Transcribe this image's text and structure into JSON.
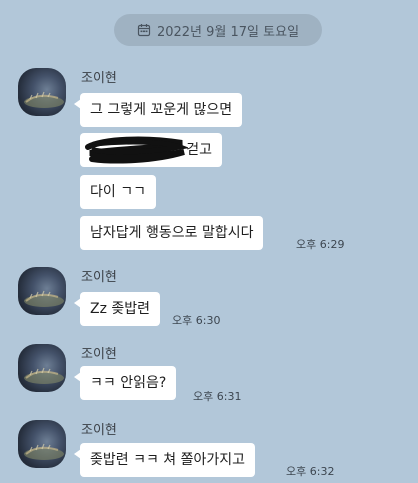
{
  "date_divider": {
    "icon": "calendar-icon",
    "text": "2022년 9월 17일 토요일"
  },
  "groups": [
    {
      "sender": "조이현",
      "messages": [
        {
          "text": "그 그렇게 꼬운게 많으면"
        },
        {
          "text": "걷고",
          "redacted": true
        },
        {
          "text": "다이 ㄱㄱ"
        },
        {
          "text": "남자답게 행동으로 말합시다",
          "time": "오후 6:29"
        }
      ]
    },
    {
      "sender": "조이현",
      "messages": [
        {
          "text": "Zz 좆밥련",
          "time": "오후 6:30"
        }
      ]
    },
    {
      "sender": "조이현",
      "messages": [
        {
          "text": "ㅋㅋ 안읽음?",
          "time": "오후 6:31"
        }
      ]
    },
    {
      "sender": "조이현",
      "messages": [
        {
          "text": "좆밥련 ㅋㅋ 쳐 쫄아가지고",
          "time": "오후 6:32"
        }
      ]
    }
  ]
}
